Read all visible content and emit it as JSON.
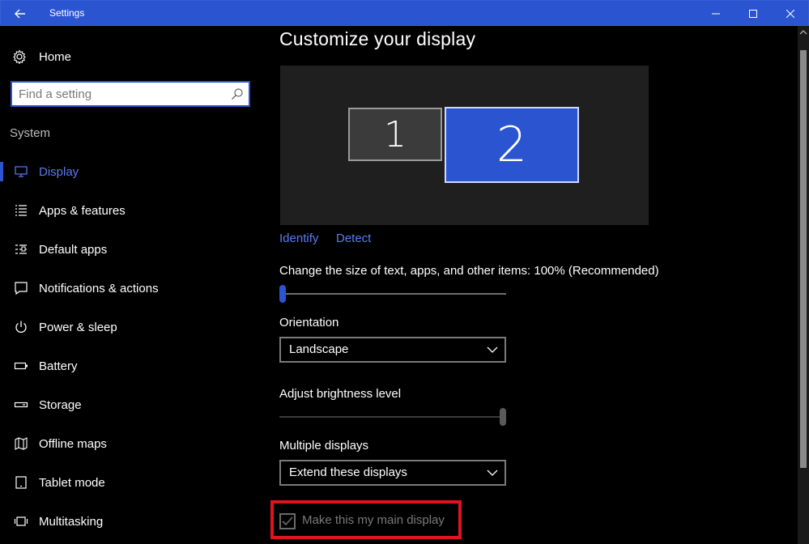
{
  "window": {
    "title": "Settings"
  },
  "sidebar": {
    "home_label": "Home",
    "search_placeholder": "Find a setting",
    "section_label": "System",
    "items": [
      {
        "label": "Display",
        "icon": "monitor-icon",
        "active": true
      },
      {
        "label": "Apps & features",
        "icon": "apps-list-icon"
      },
      {
        "label": "Default apps",
        "icon": "default-apps-icon"
      },
      {
        "label": "Notifications & actions",
        "icon": "notification-icon"
      },
      {
        "label": "Power & sleep",
        "icon": "power-icon"
      },
      {
        "label": "Battery",
        "icon": "battery-icon"
      },
      {
        "label": "Storage",
        "icon": "storage-icon"
      },
      {
        "label": "Offline maps",
        "icon": "map-icon"
      },
      {
        "label": "Tablet mode",
        "icon": "tablet-icon"
      },
      {
        "label": "Multitasking",
        "icon": "multitasking-icon"
      }
    ]
  },
  "main": {
    "title": "Customize your display",
    "monitors": [
      {
        "number": "1",
        "selected": false
      },
      {
        "number": "2",
        "selected": true
      }
    ],
    "identify_label": "Identify",
    "detect_label": "Detect",
    "scale_label": "Change the size of text, apps, and other items: 100% (Recommended)",
    "scale_level": 0.0,
    "orientation_label": "Orientation",
    "orientation_value": "Landscape",
    "brightness_label": "Adjust brightness level",
    "brightness_level": 1.0,
    "multiple_displays_label": "Multiple displays",
    "multiple_displays_value": "Extend these displays",
    "main_display_checkbox_label": "Make this my main display",
    "main_display_checked": true,
    "main_display_disabled": true
  },
  "colors": {
    "accent": "#2b54d1",
    "link": "#5b7cf0",
    "highlight": "#e0141c",
    "background": "#000000"
  }
}
